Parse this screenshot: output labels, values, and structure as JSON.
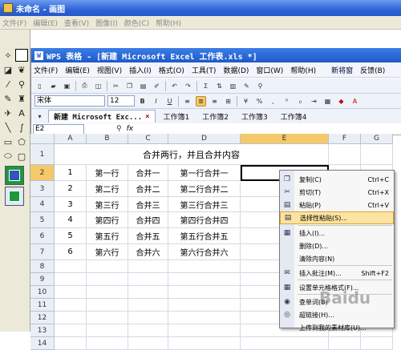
{
  "paint": {
    "title": "未命名 - 画图",
    "menu": [
      "文件(F)",
      "编辑(E)",
      "查看(V)",
      "图像(I)",
      "颜色(C)",
      "帮助(H)"
    ]
  },
  "wps": {
    "title": "WPS 表格 - [新建 Microsoft Excel 工作表.xls *]",
    "menu": [
      "文件(F)",
      "编辑(E)",
      "视图(V)",
      "插入(I)",
      "格式(O)",
      "工具(T)",
      "数据(D)",
      "窗口(W)",
      "帮助(H)"
    ],
    "new_window": "新将窗",
    "feedback": "反馈(B)",
    "font_name": "宋体",
    "font_size": "12",
    "tabs": [
      {
        "label": "新建 Microsoft Exc...",
        "active": true
      },
      {
        "label": "工作簿1"
      },
      {
        "label": "工作簿2"
      },
      {
        "label": "工作簿3"
      },
      {
        "label": "工作簿4"
      }
    ],
    "name_box": "E2",
    "fx": "fx"
  },
  "sheet": {
    "columns": [
      "A",
      "B",
      "C",
      "D",
      "E",
      "F",
      "G"
    ],
    "rows": [
      "1",
      "2",
      "3",
      "4",
      "5",
      "6",
      "7",
      "8",
      "9",
      "10",
      "11",
      "12",
      "13",
      "14"
    ],
    "row1_merged": "合并两行，并且合并内容",
    "data": [
      [
        "1",
        "第一行",
        "合并一",
        "第一行合并一"
      ],
      [
        "2",
        "第二行",
        "合并二",
        "第二行合并二"
      ],
      [
        "3",
        "第三行",
        "合并三",
        "第三行合并三"
      ],
      [
        "4",
        "第四行",
        "合并四",
        "第四行合并四"
      ],
      [
        "5",
        "第五行",
        "合并五",
        "第五行合并五"
      ],
      [
        "6",
        "第六行",
        "合并六",
        "第六行合并六"
      ]
    ]
  },
  "context_menu": [
    {
      "icon": "scissors-copy-icon",
      "label": "复制(C)",
      "shortcut": "Ctrl+C"
    },
    {
      "icon": "scissors-icon",
      "label": "剪切(T)",
      "shortcut": "Ctrl+X"
    },
    {
      "icon": "paste-icon",
      "label": "粘贴(P)",
      "shortcut": "Ctrl+V"
    },
    {
      "icon": "paste-special-icon",
      "label": "选择性粘贴(S)...",
      "shortcut": "",
      "highlighted": true
    },
    {
      "icon": "insert-icon",
      "label": "插入(I)...",
      "shortcut": ""
    },
    {
      "icon": "",
      "label": "删除(D)...",
      "shortcut": ""
    },
    {
      "icon": "",
      "label": "清除内容(N)",
      "shortcut": ""
    },
    {
      "icon": "comment-icon",
      "label": "插入批注(M)...",
      "shortcut": "Shift+F2"
    },
    {
      "icon": "format-cells-icon",
      "label": "设置单元格格式(F)...",
      "shortcut": ""
    },
    {
      "icon": "dictionary-icon",
      "label": "查单词(B)",
      "shortcut": ""
    },
    {
      "icon": "hyperlink-icon",
      "label": "超链接(H)...",
      "shortcut": ""
    },
    {
      "icon": "",
      "label": "上传到我的素材库(U)...",
      "shortcut": ""
    }
  ],
  "watermark": "Baidu"
}
